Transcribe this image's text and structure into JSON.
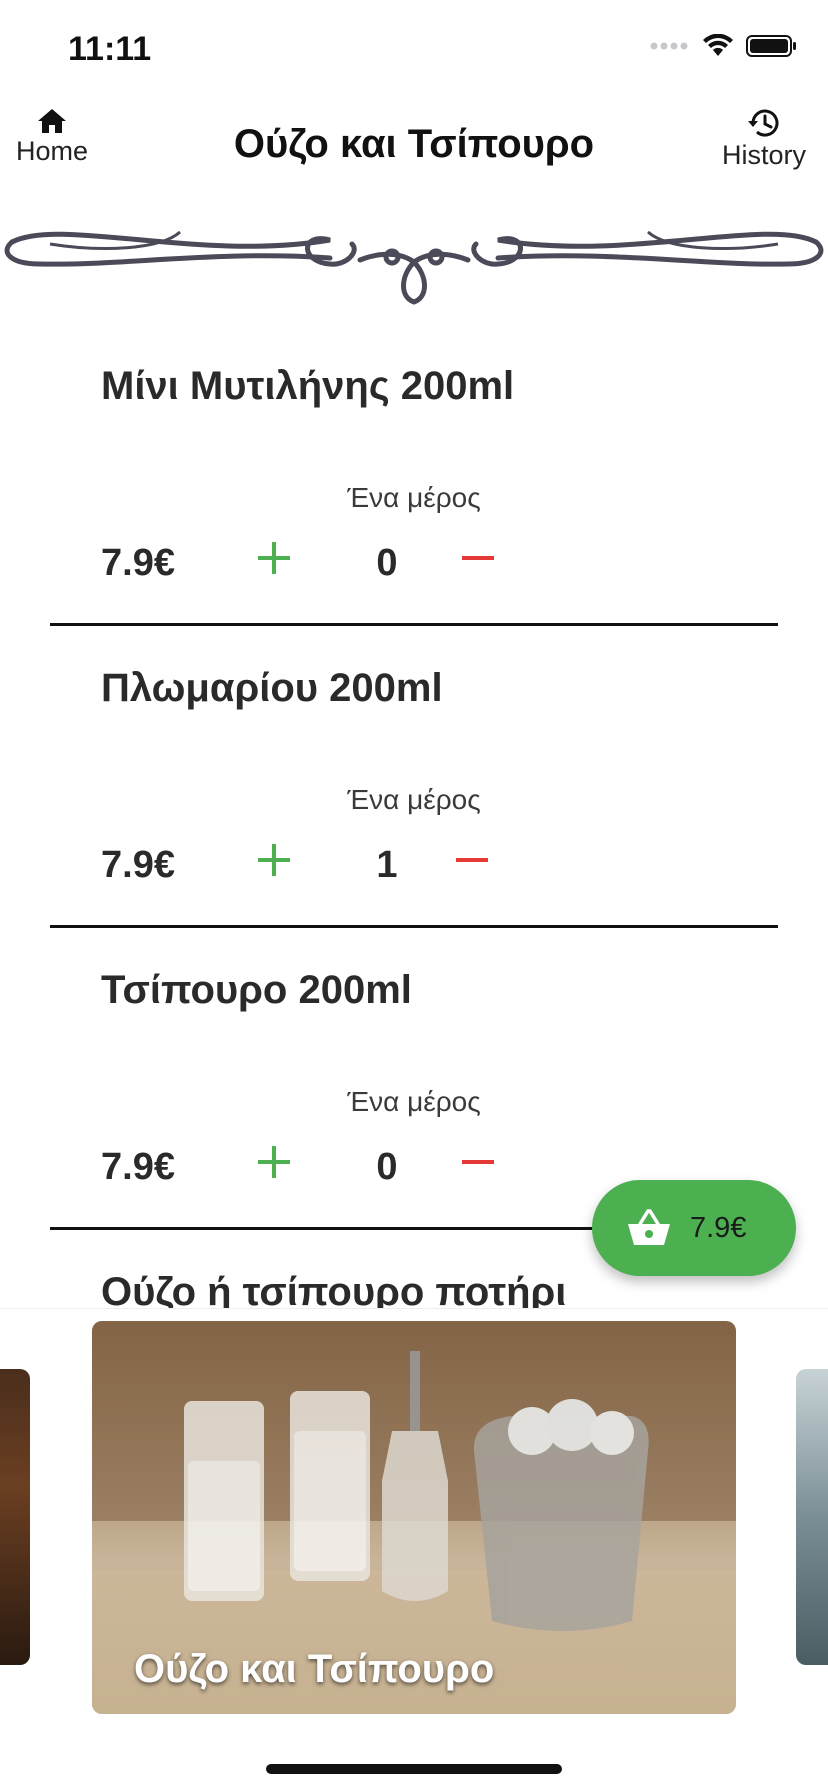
{
  "status_bar": {
    "time": "11:11"
  },
  "nav": {
    "home_label": "Home",
    "title": "Ούζο και Τσίπουρο",
    "history_label": "History"
  },
  "products": [
    {
      "name": "Μίνι Μυτιλήνης 200ml",
      "portion": "Ένα μέρος",
      "price": "7.9€",
      "quantity": "0"
    },
    {
      "name": "Πλωμαρίου 200ml",
      "portion": "Ένα μέρος",
      "price": "7.9€",
      "quantity": "1"
    },
    {
      "name": "Τσίπουρο 200ml",
      "portion": "Ένα μέρος",
      "price": "7.9€",
      "quantity": "0"
    },
    {
      "name": "Ούζο ή τσίπουρο ποτήρι"
    }
  ],
  "cart": {
    "total": "7.9€"
  },
  "carousel": {
    "main_card_title": "Ούζο και Τσίπουρο"
  },
  "colors": {
    "accent_green": "#4caf50",
    "minus_red": "#e53935",
    "plus_green": "#4caf50"
  },
  "icons": {
    "home": "home-icon",
    "history": "history-icon",
    "plus": "plus-icon",
    "minus": "minus-icon",
    "basket": "basket-icon",
    "ornament": "ornament-divider"
  }
}
